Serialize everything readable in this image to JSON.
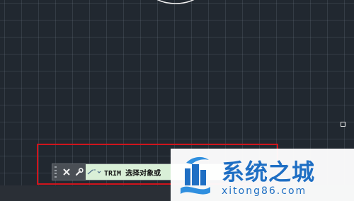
{
  "command_line": {
    "text": "TRIM 选择对象或",
    "close_icon": "close-icon",
    "settings_icon": "wrench-icon",
    "prompt_icon": "command-prompt-icon"
  },
  "watermark": {
    "title": "系统之城",
    "url": "xitong86.com"
  },
  "colors": {
    "canvas_bg": "#212830",
    "highlight_border": "#d0141c",
    "prompt_bg": "#d9efd7",
    "watermark_blue": "#1f6fc4"
  }
}
